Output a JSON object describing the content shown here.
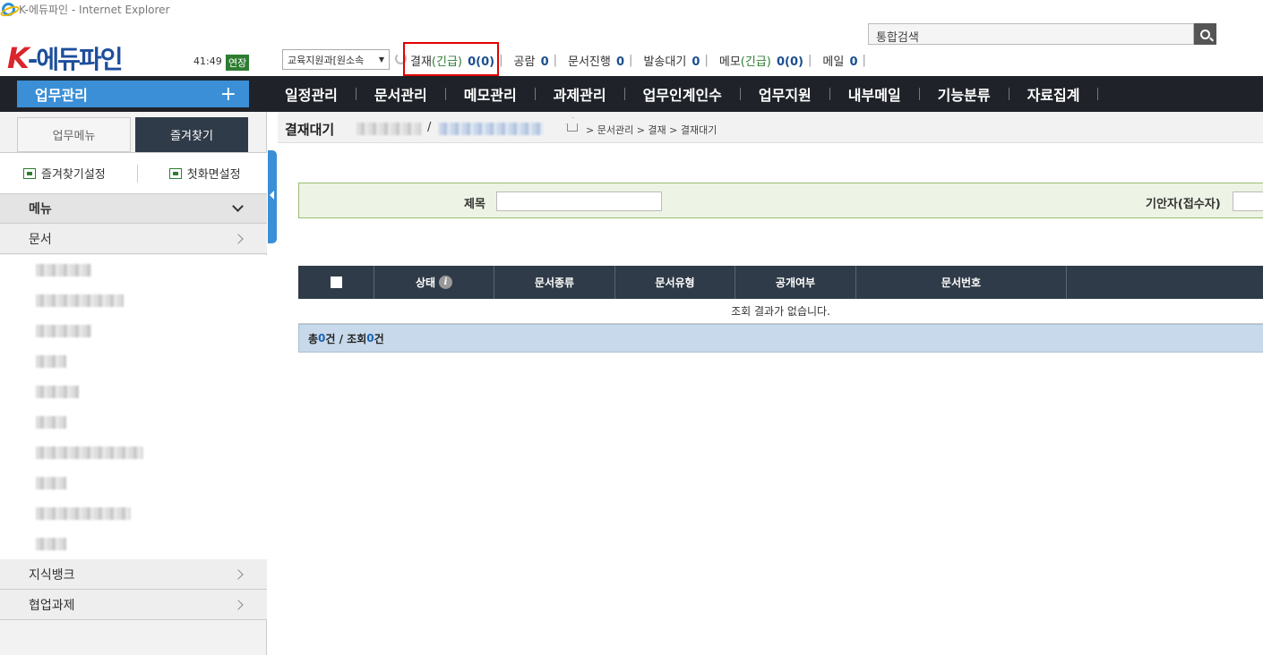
{
  "window": {
    "title": "K-에듀파인 - Internet Explorer"
  },
  "header": {
    "logo_k": "K",
    "logo_rest": "-에듀파인",
    "timer": "41:49",
    "extend_label": "연장",
    "dept_select": "교육지원과[원소속",
    "status_items": [
      {
        "label": "결재",
        "urgent": "(긴급)",
        "value": "0(0)"
      },
      {
        "label": "공람",
        "value": "0"
      },
      {
        "label": "문서진행",
        "value": "0"
      },
      {
        "label": "발송대기",
        "value": "0"
      },
      {
        "label": "메모",
        "urgent": "(긴급)",
        "value": "0(0)"
      },
      {
        "label": "메일",
        "value": "0"
      }
    ],
    "search_placeholder": "통합검색"
  },
  "nav": {
    "work_label": "업무관리",
    "work_plus": "+",
    "menus": [
      "일정관리",
      "문서관리",
      "메모관리",
      "과제관리",
      "업무인계인수",
      "업무지원",
      "내부메일",
      "기능분류",
      "자료집계"
    ]
  },
  "sidebar": {
    "tabs": [
      "업무메뉴",
      "즐겨찾기"
    ],
    "actions": [
      "즐겨찾기설정",
      "첫화면설정"
    ],
    "menu_head": "메뉴",
    "rows": [
      "문서",
      "지식뱅크",
      "협업과제"
    ]
  },
  "content": {
    "page_title": "결재대기",
    "crumb_sep": "/",
    "breadcrumb": "> 문서관리 > 결재 > 결재대기",
    "search": {
      "title_label": "제목",
      "drafter_label": "기안자(접수자)"
    },
    "table": {
      "headers": [
        "상태",
        "문서종류",
        "문서유형",
        "공개여부",
        "문서번호",
        ""
      ],
      "empty_message": "조회 결과가 없습니다.",
      "total_prefix": "총 ",
      "total_count": "0",
      "total_mid": "건 / 조회 ",
      "view_count": "0",
      "total_suffix": "건"
    }
  },
  "colors": {
    "nav_bg": "#1f2329",
    "accent": "#3a8fd6",
    "highlight": "#e00000"
  }
}
